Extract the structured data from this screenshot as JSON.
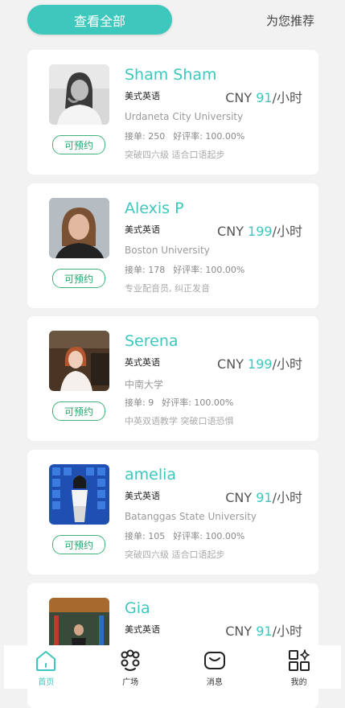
{
  "header": {
    "view_all_label": "查看全部",
    "recommend_label": "为您推荐"
  },
  "colors": {
    "accent": "#3ec8bd",
    "badge": "#2ea36b"
  },
  "tutors": [
    {
      "name": "Sham Sham",
      "language": "美式英语",
      "price_prefix": "CNY ",
      "price_value": "91",
      "price_suffix": "/小时",
      "school": "Urdaneta City University",
      "orders": "接单: 250",
      "rating": "好评率: 100.00%",
      "tags": "突破四六级  适合口语起步",
      "book_label": "可预约"
    },
    {
      "name": "Alexis P",
      "language": "美式英语",
      "price_prefix": "CNY ",
      "price_value": "199",
      "price_suffix": "/小时",
      "school": "Boston University",
      "orders": "接单: 178",
      "rating": "好评率: 100.00%",
      "tags": "专业配音员, 纠正发音",
      "book_label": "可预约"
    },
    {
      "name": "Serena",
      "language": "英式英语",
      "price_prefix": "CNY ",
      "price_value": "199",
      "price_suffix": "/小时",
      "school": "中南大学",
      "orders": "接单:  9",
      "rating": "好评率: 100.00%",
      "tags": "中英双语教学 突破口语恐惧",
      "book_label": "可预约"
    },
    {
      "name": "amelia",
      "language": "美式英语",
      "price_prefix": "CNY ",
      "price_value": "91",
      "price_suffix": "/小时",
      "school": "Batanggas State University",
      "orders": "接单: 105",
      "rating": "好评率: 100.00%",
      "tags": "突破四六级  适合口语起步",
      "book_label": "可预约"
    },
    {
      "name": "Gia",
      "language": "美式英语",
      "price_prefix": "CNY ",
      "price_value": "91",
      "price_suffix": "/小时"
    }
  ],
  "tabbar": {
    "items": [
      {
        "label": "首页",
        "icon": "home-icon"
      },
      {
        "label": "广场",
        "icon": "community-icon"
      },
      {
        "label": "消息",
        "icon": "message-icon"
      },
      {
        "label": "我的",
        "icon": "profile-grid-icon"
      }
    ]
  }
}
